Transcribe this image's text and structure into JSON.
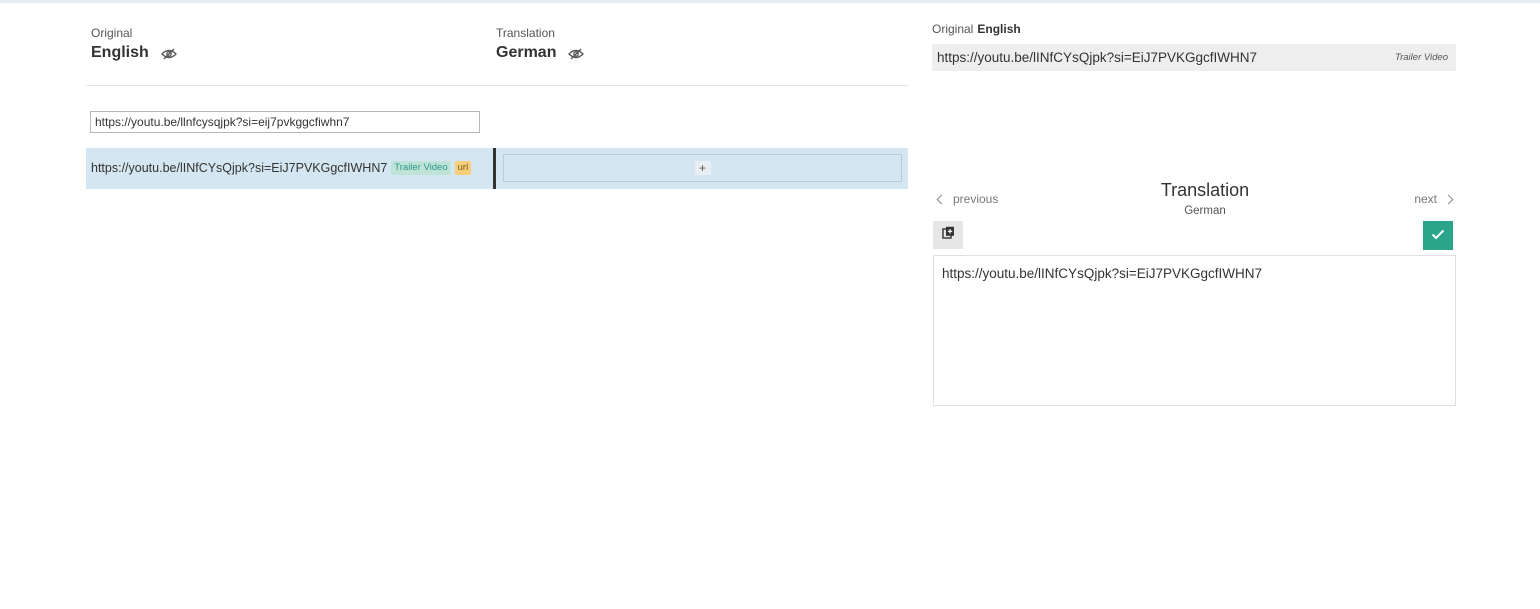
{
  "left_panel": {
    "original": {
      "caption": "Original",
      "language": "English"
    },
    "translation": {
      "caption": "Translation",
      "language": "German"
    },
    "filter": {
      "value": "https://youtu.be/llnfcysqjpk?si=eij7pvkggcfiwhn7",
      "placeholder": ""
    },
    "rows": [
      {
        "source": "https://youtu.be/lINfCYsQjpk?si=EiJ7PVKGgcfIWHN7",
        "tags": [
          "Trailer Video",
          "url"
        ],
        "add_label": "+"
      }
    ]
  },
  "right_panel": {
    "original_caption": "Original",
    "original_language": "English",
    "original_text": "https://youtu.be/lINfCYsQjpk?si=EiJ7PVKGgcfIWHN7",
    "context": "Trailer Video",
    "nav": {
      "previous": "previous",
      "next": "next"
    },
    "title": "Translation",
    "language": "German",
    "editor_value": "https://youtu.be/lINfCYsQjpk?si=EiJ7PVKGgcfIWHN7"
  },
  "icons": {
    "visibility": "eye-off-icon",
    "copy": "copy-icon",
    "confirm": "check-icon",
    "prev": "chevron-left-icon",
    "next": "chevron-right-icon"
  },
  "colors": {
    "row_highlight": "#d4e6f1",
    "confirm_button": "#2aa58a",
    "context_tag": "#bfe3d9",
    "type_tag": "#f7cf7b"
  }
}
